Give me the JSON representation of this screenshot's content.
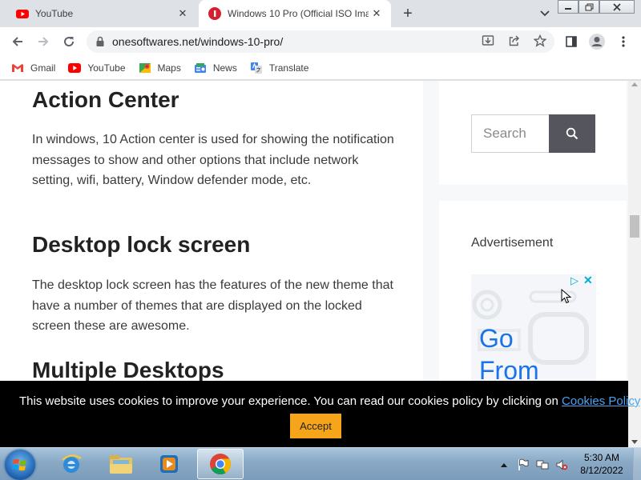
{
  "tabs": [
    {
      "title": "YouTube",
      "active": false,
      "icon": "youtube-icon"
    },
    {
      "title": "Windows 10 Pro (Official ISO Ima",
      "active": true,
      "icon": "onesoftwares-icon"
    }
  ],
  "toolbar": {
    "url": "onesoftwares.net/windows-10-pro/"
  },
  "bookmarks": [
    {
      "label": "Gmail",
      "icon": "gmail-icon"
    },
    {
      "label": "YouTube",
      "icon": "youtube-icon"
    },
    {
      "label": "Maps",
      "icon": "maps-icon"
    },
    {
      "label": "News",
      "icon": "news-icon"
    },
    {
      "label": "Translate",
      "icon": "translate-icon"
    }
  ],
  "article": {
    "heading1": "Action Center",
    "para1": "In windows, 10 Action center is used for showing the notification messages to show and other options that include network setting, wifi, battery, Window defender mode, etc.",
    "heading2": "Desktop lock screen",
    "para2": "The desktop lock screen has the features of the new theme that have a number of themes that are displayed on the locked screen these are awesome.",
    "heading3": "Multiple Desktops"
  },
  "sidebar": {
    "search_placeholder": "Search",
    "ad_label": "Advertisement",
    "ad_text_line1": "Go",
    "ad_text_line2": "From"
  },
  "cookie": {
    "text": "This website uses cookies to improve your experience. You can read our cookies policy by clicking on ",
    "link": "Cookies Policy",
    "period": ".",
    "accept": "Accept"
  },
  "taskbar": {
    "time": "5:30 AM",
    "date": "8/12/2022"
  },
  "colors": {
    "cookie_banner": "#000000",
    "accept_button": "#f6a51b",
    "link": "#4aa3f0",
    "search_button": "#55555e"
  }
}
